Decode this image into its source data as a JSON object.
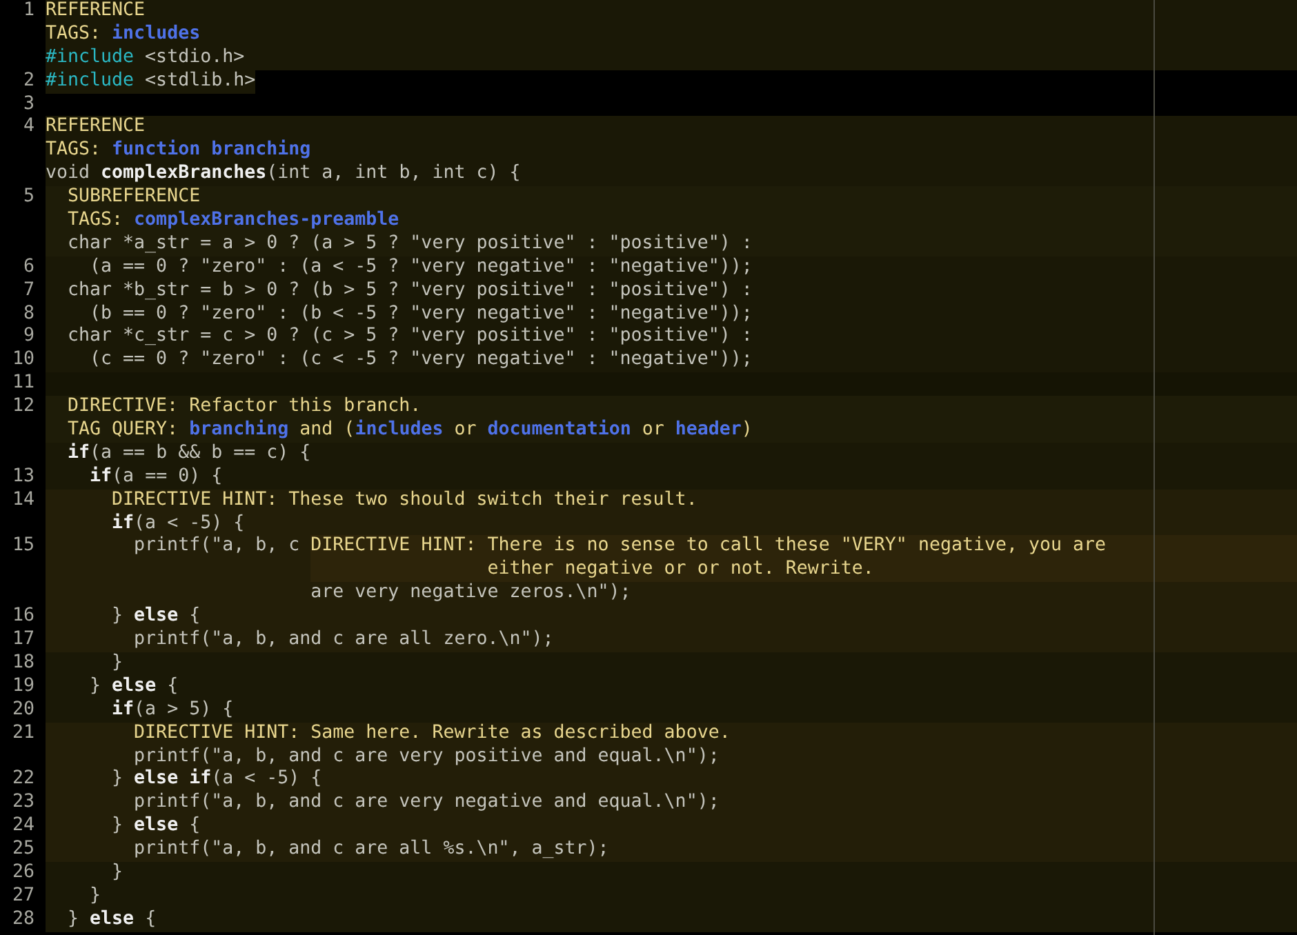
{
  "editor": {
    "rows": [
      {
        "number": "1",
        "kind": "ref",
        "segs": [
          {
            "kind": "label",
            "t": "REFERENCE"
          }
        ]
      },
      {
        "number": "",
        "kind": "ref",
        "segs": [
          {
            "kind": "label",
            "t": "TAGS: "
          },
          {
            "kind": "tag",
            "t": "includes"
          }
        ]
      },
      {
        "number": "",
        "kind": "ref",
        "segs": [
          {
            "kind": "pre",
            "t": "#include"
          },
          {
            "kind": "text",
            "t": " <stdio.h>"
          }
        ]
      },
      {
        "number": "2",
        "kind": "inline",
        "segs": [
          {
            "kind": "pre",
            "t": "#include"
          },
          {
            "kind": "text",
            "t": " <stdlib.h>"
          }
        ]
      },
      {
        "number": "3",
        "kind": "none",
        "segs": []
      },
      {
        "number": "4",
        "kind": "ref",
        "segs": [
          {
            "kind": "label",
            "t": "REFERENCE"
          }
        ]
      },
      {
        "number": "",
        "kind": "ref",
        "segs": [
          {
            "kind": "label",
            "t": "TAGS: "
          },
          {
            "kind": "tag",
            "t": "function"
          },
          {
            "kind": "tag",
            "t": " branching"
          }
        ]
      },
      {
        "number": "",
        "kind": "ref",
        "segs": [
          {
            "kind": "text",
            "t": "void "
          },
          {
            "kind": "kw",
            "t": "complexBranches"
          },
          {
            "kind": "text",
            "t": "(int a, int b, int c) {"
          }
        ]
      },
      {
        "number": "5",
        "kind": "head",
        "segs": [
          {
            "kind": "label",
            "t": "  SUBREFERENCE"
          }
        ]
      },
      {
        "number": "",
        "kind": "head",
        "segs": [
          {
            "kind": "label",
            "t": "  TAGS: "
          },
          {
            "kind": "tag",
            "t": "complexBranches-preamble"
          }
        ]
      },
      {
        "number": "",
        "kind": "head",
        "segs": [
          {
            "kind": "text",
            "t": "  char *a_str = a > 0 ? (a > 5 ? \"very positive\" : \"positive\") :"
          }
        ]
      },
      {
        "number": "6",
        "kind": "ref",
        "segs": [
          {
            "kind": "text",
            "t": "    (a == 0 ? \"zero\" : (a < -5 ? \"very negative\" : \"negative\"));"
          }
        ]
      },
      {
        "number": "7",
        "kind": "ref",
        "segs": [
          {
            "kind": "text",
            "t": "  char *b_str = b > 0 ? (b > 5 ? \"very positive\" : \"positive\") :"
          }
        ]
      },
      {
        "number": "8",
        "kind": "ref",
        "segs": [
          {
            "kind": "text",
            "t": "    (b == 0 ? \"zero\" : (b < -5 ? \"very negative\" : \"negative\"));"
          }
        ]
      },
      {
        "number": "9",
        "kind": "ref",
        "segs": [
          {
            "kind": "text",
            "t": "  char *c_str = c > 0 ? (c > 5 ? \"very positive\" : \"positive\") :"
          }
        ]
      },
      {
        "number": "10",
        "kind": "ref",
        "segs": [
          {
            "kind": "text",
            "t": "    (c == 0 ? \"zero\" : (c < -5 ? \"very negative\" : \"negative\"));"
          }
        ]
      },
      {
        "number": "11",
        "kind": "dim",
        "segs": []
      },
      {
        "number": "12",
        "kind": "head",
        "segs": [
          {
            "kind": "label",
            "t": "  DIRECTIVE: Refactor this branch."
          }
        ]
      },
      {
        "number": "",
        "kind": "head",
        "segs": [
          {
            "kind": "label",
            "t": "  TAG QUERY: "
          },
          {
            "kind": "tag",
            "t": "branching"
          },
          {
            "kind": "label",
            "t": " and ("
          },
          {
            "kind": "tag",
            "t": "includes"
          },
          {
            "kind": "label",
            "t": " or "
          },
          {
            "kind": "tag",
            "t": "documentation"
          },
          {
            "kind": "label",
            "t": " or "
          },
          {
            "kind": "tag",
            "t": "header"
          },
          {
            "kind": "label",
            "t": ")"
          }
        ]
      },
      {
        "number": "",
        "kind": "ref",
        "segs": [
          {
            "kind": "kw",
            "t": "  if"
          },
          {
            "kind": "text",
            "t": "(a == b && b == c) {"
          }
        ]
      },
      {
        "number": "13",
        "kind": "ref",
        "segs": [
          {
            "kind": "kw",
            "t": "    if"
          },
          {
            "kind": "text",
            "t": "(a == 0) {"
          }
        ]
      },
      {
        "number": "14",
        "kind": "hint",
        "segs": [
          {
            "kind": "label",
            "t": "      DIRECTIVE HINT: These two should switch their result."
          }
        ]
      },
      {
        "number": "",
        "kind": "hint",
        "segs": [
          {
            "kind": "kw",
            "t": "      if"
          },
          {
            "kind": "text",
            "t": "(a < -5) {"
          }
        ]
      },
      {
        "number": "15",
        "kind": "hint",
        "segs": [
          {
            "kind": "text",
            "t": "        printf(\"a, b, c "
          },
          {
            "kind": "note",
            "t": "DIRECTIVE HINT: There is no sense to call these \"VERY\" negative, you are"
          }
        ]
      },
      {
        "number": "",
        "kind": "notecont",
        "segs": [
          {
            "kind": "label",
            "t": "                                        either negative or or not. Rewrite."
          }
        ]
      },
      {
        "number": "",
        "kind": "hint",
        "segs": [
          {
            "kind": "text",
            "t": "                        are very negative zeros.\\n\");"
          }
        ]
      },
      {
        "number": "16",
        "kind": "hint",
        "segs": [
          {
            "kind": "text",
            "t": "      } "
          },
          {
            "kind": "kw",
            "t": "else"
          },
          {
            "kind": "text",
            "t": " {"
          }
        ]
      },
      {
        "number": "17",
        "kind": "hint",
        "segs": [
          {
            "kind": "text",
            "t": "        printf(\"a, b, and c are all zero.\\n\");"
          }
        ]
      },
      {
        "number": "18",
        "kind": "ref",
        "segs": [
          {
            "kind": "text",
            "t": "      }"
          }
        ]
      },
      {
        "number": "19",
        "kind": "ref",
        "segs": [
          {
            "kind": "text",
            "t": "    } "
          },
          {
            "kind": "kw",
            "t": "else"
          },
          {
            "kind": "text",
            "t": " {"
          }
        ]
      },
      {
        "number": "20",
        "kind": "ref",
        "segs": [
          {
            "kind": "kw",
            "t": "      if"
          },
          {
            "kind": "text",
            "t": "(a > 5) {"
          }
        ]
      },
      {
        "number": "21",
        "kind": "hint",
        "segs": [
          {
            "kind": "label",
            "t": "        DIRECTIVE HINT: Same here. Rewrite as described above."
          }
        ]
      },
      {
        "number": "",
        "kind": "hint",
        "segs": [
          {
            "kind": "text",
            "t": "        printf(\"a, b, and c are very positive and equal.\\n\");"
          }
        ]
      },
      {
        "number": "22",
        "kind": "hint",
        "segs": [
          {
            "kind": "text",
            "t": "      } "
          },
          {
            "kind": "kw",
            "t": "else if"
          },
          {
            "kind": "text",
            "t": "(a < -5) {"
          }
        ]
      },
      {
        "number": "23",
        "kind": "hint",
        "segs": [
          {
            "kind": "text",
            "t": "        printf(\"a, b, and c are very negative and equal.\\n\");"
          }
        ]
      },
      {
        "number": "24",
        "kind": "hint",
        "segs": [
          {
            "kind": "text",
            "t": "      } "
          },
          {
            "kind": "kw",
            "t": "else"
          },
          {
            "kind": "text",
            "t": " {"
          }
        ]
      },
      {
        "number": "25",
        "kind": "hint",
        "segs": [
          {
            "kind": "text",
            "t": "        printf(\"a, b, and c are all %s.\\n\", a_str);"
          }
        ]
      },
      {
        "number": "26",
        "kind": "ref",
        "segs": [
          {
            "kind": "text",
            "t": "      }"
          }
        ]
      },
      {
        "number": "27",
        "kind": "ref",
        "segs": [
          {
            "kind": "text",
            "t": "    }"
          }
        ]
      },
      {
        "number": "28",
        "kind": "ref",
        "segs": [
          {
            "kind": "text",
            "t": "  } "
          },
          {
            "kind": "kw",
            "t": "else"
          },
          {
            "kind": "text",
            "t": " {"
          }
        ]
      }
    ]
  }
}
